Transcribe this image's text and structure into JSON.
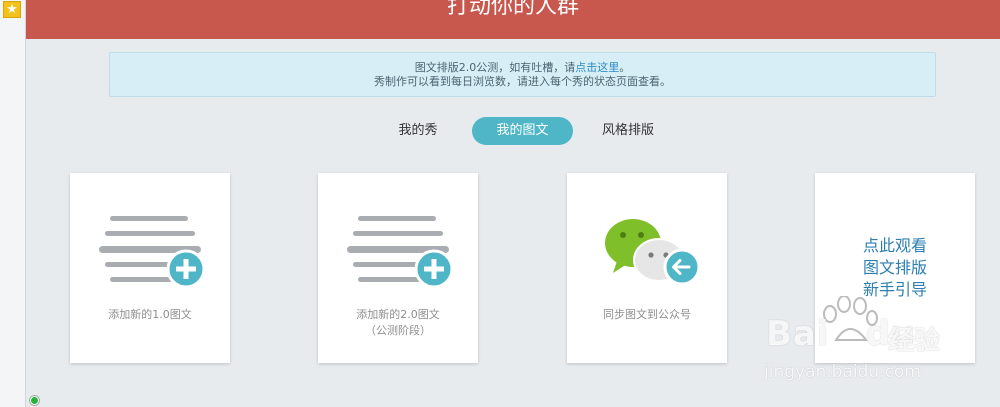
{
  "banner": {
    "title": "打动你的人群"
  },
  "notice": {
    "line1_prefix": "图文排版2.0公测，如有吐槽，请",
    "line1_link": "点击这里",
    "line1_suffix": "。",
    "line2": "秀制作可以看到每日浏览数，请进入每个秀的状态页面查看。"
  },
  "tabs": [
    {
      "label": "我的秀",
      "active": false
    },
    {
      "label": "我的图文",
      "active": true
    },
    {
      "label": "风格排版",
      "active": false
    }
  ],
  "cards": [
    {
      "label": "添加新的1.0图文",
      "icon": "article-add-icon"
    },
    {
      "label_line1": "添加新的2.0图文",
      "label_line2": "（公测阶段）",
      "icon": "article-add-icon"
    },
    {
      "label": "同步图文到公众号",
      "icon": "wechat-sync-icon"
    },
    {
      "guide_lines": [
        "点此观看",
        "图文排版",
        "新手引导"
      ]
    }
  ],
  "watermark": {
    "brand": "Bai",
    "brand_tail": "du",
    "cn": "经验",
    "url": "jingyan.baidu.com"
  },
  "colors": {
    "banner": "#c8574e",
    "accent": "#4fb6c8",
    "notice_bg": "#d8eef7",
    "guide_text": "#2d7fb0"
  }
}
